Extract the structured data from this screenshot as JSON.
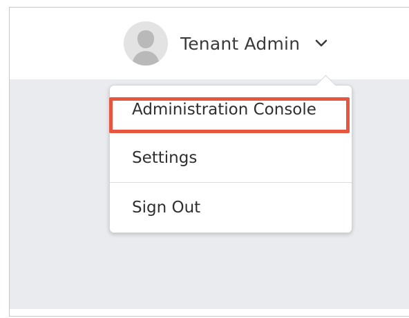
{
  "user_menu": {
    "name": "Tenant Admin",
    "avatar_icon": "user-avatar-icon",
    "toggle_icon": "chevron-down-icon"
  },
  "dropdown": {
    "items": [
      {
        "label": "Administration Console",
        "highlighted": true
      },
      {
        "label": "Settings",
        "highlighted": false
      },
      {
        "label": "Sign Out",
        "highlighted": false
      }
    ],
    "highlight_color": "#e8553f"
  },
  "colors": {
    "content_background": "#e9ebee",
    "text": "#3a3a3a"
  }
}
